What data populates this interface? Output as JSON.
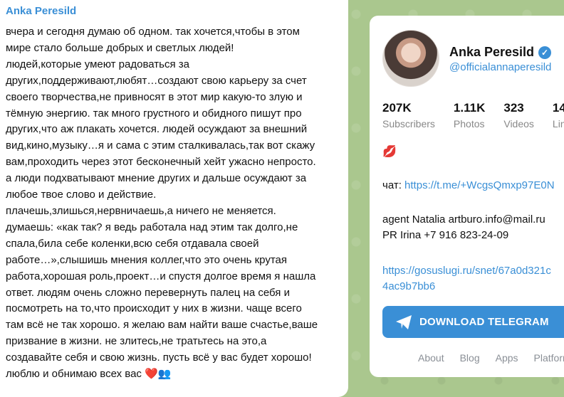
{
  "message": {
    "author": "Anka Peresild",
    "lines": [
      "вчера и сегодня думаю об одном. так хочется,чтобы в этом",
      "мире стало больше добрых и светлых людей!",
      "людей,которые умеют радоваться за",
      "других,поддерживают,любят…создают свою карьеру за счет",
      "своего творчества,не привносят в этот мир какую-то злую и",
      "тёмную энергию. так много грустного и обидного пишут про",
      "других,что аж плакать хочется. людей осуждают за внешний",
      "вид,кино,музыку…я и сама с этим сталкивалась,так вот скажу",
      "вам,проходить через этот бесконечный хейт ужасно непросто.",
      "а люди подхватывают мнение других и дальше осуждают за",
      "любое твое слово и действие.",
      "плачешь,злишься,нервничаешь,а ничего не меняется.",
      "думаешь: «как так? я ведь работала над этим так долго,не",
      "спала,била себе коленки,всю себя отдавала своей",
      "работе…»,слышишь мнения коллег,что это очень крутая",
      "работа,хорошая роль,проект…и спустя долгое время я нашла",
      "ответ. людям очень сложно перевернуть палец на себя и",
      "посмотреть на то,что происходит у них в жизни. чаще всего",
      "там всё не так хорошо. я желаю вам найти ваше счастье,ваше",
      "призвание в жизни. не злитесь,не тратьтесь на это,а",
      "создавайте себя и свою жизнь. пусть всё у вас будет хорошо!",
      "люблю и обнимаю всех вас"
    ],
    "emoji_heart": "❤️",
    "emoji_people": "👥"
  },
  "channel": {
    "name": "Anka Peresild",
    "handle": "@officialannaperesild",
    "stats": [
      {
        "value": "207K",
        "label": "Subscribers"
      },
      {
        "value": "1.11K",
        "label": "Photos"
      },
      {
        "value": "323",
        "label": "Videos"
      },
      {
        "value": "14",
        "label": "Lin"
      }
    ],
    "lips_emoji": "💋",
    "chat_label": "чат:",
    "chat_link": "https://t.me/+WcgsQmxp97E0N",
    "agent_line": "agent Natalia artburo.info@mail.ru",
    "pr_line": "PR Irina +7 916 823-24-09",
    "link_line1": "https://gosuslugi.ru/snet/67a0d321c",
    "link_line2": "4ac9b7bb6",
    "download_label": "DOWNLOAD TELEGRAM",
    "footer": [
      "About",
      "Blog",
      "Apps",
      "Platform"
    ]
  },
  "colors": {
    "accent": "#3a8fd6",
    "background": "#aac78e"
  }
}
